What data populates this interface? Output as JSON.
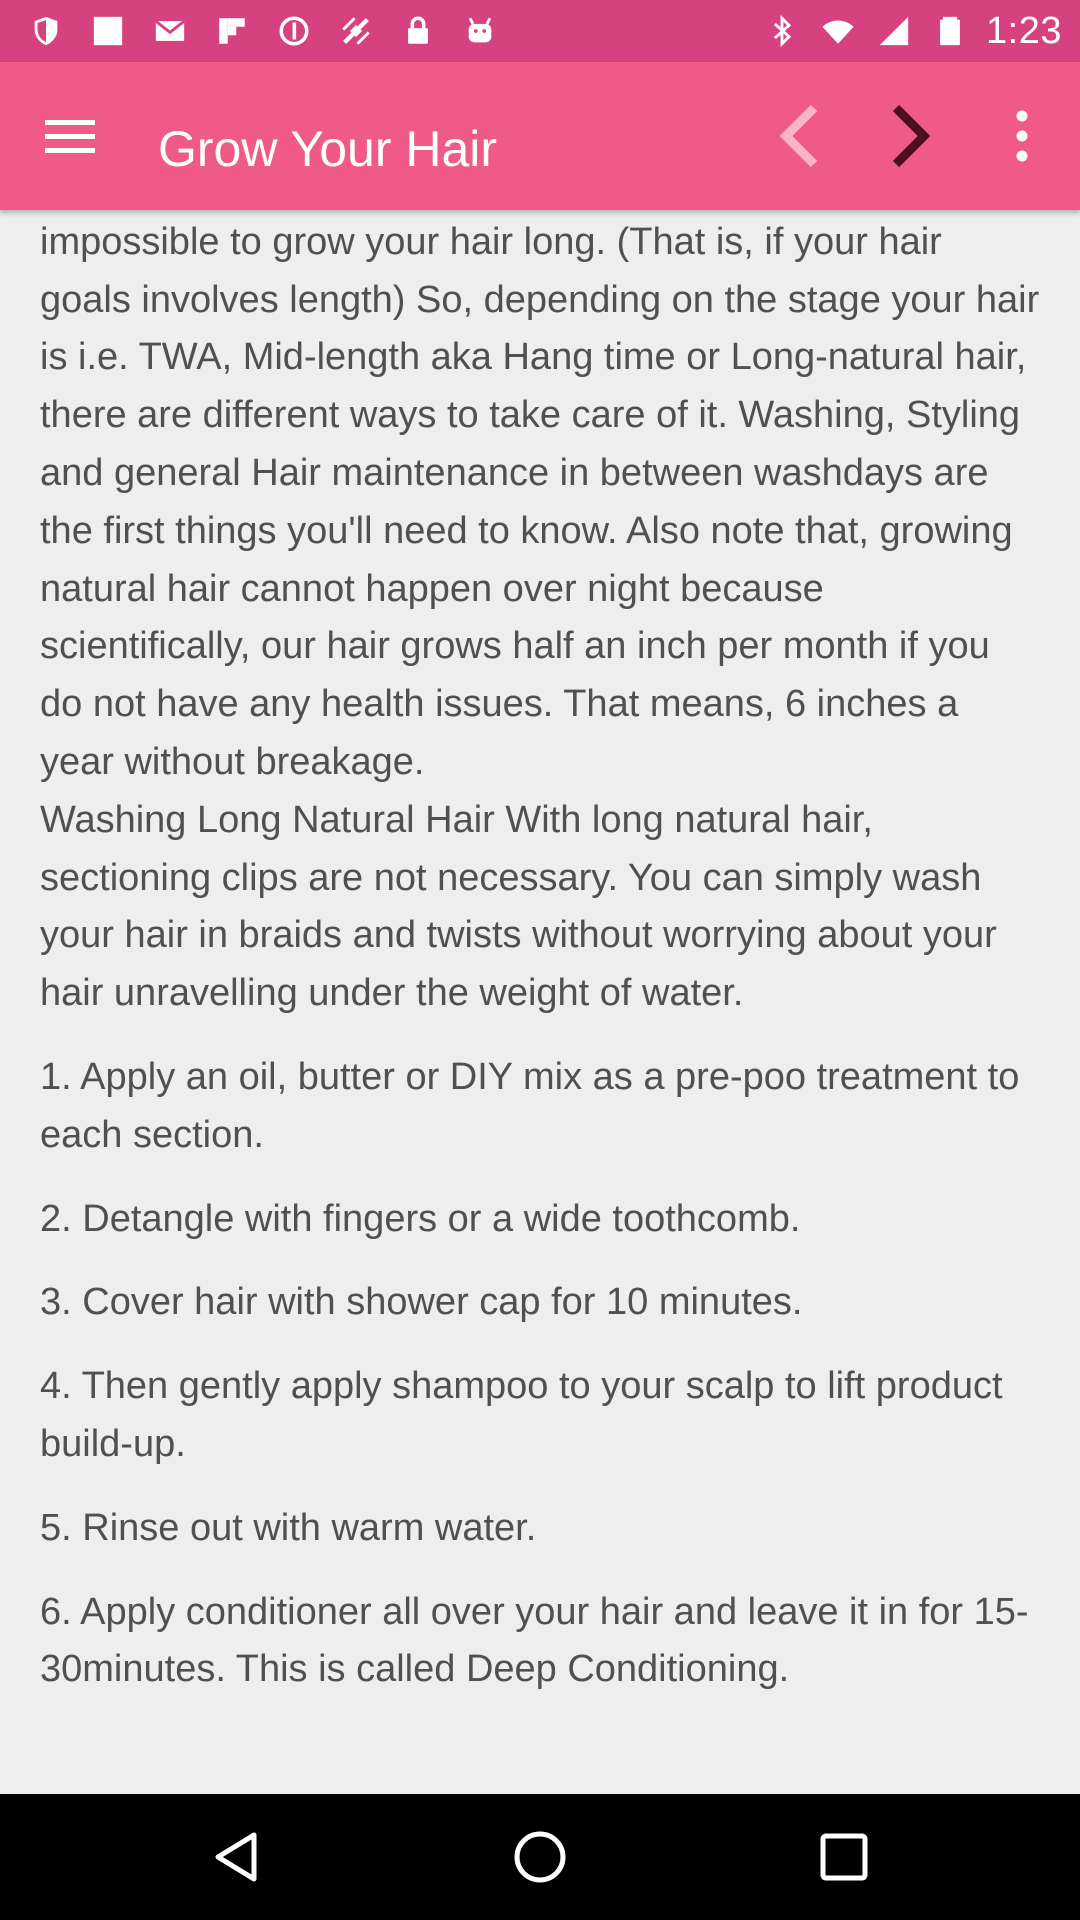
{
  "status_bar": {
    "time": "1:23",
    "left_icons": [
      "shield-icon",
      "blank-notification-icon",
      "mail-icon",
      "flipboard-icon",
      "circle-info-icon",
      "fake-gps-icon",
      "lock-icon",
      "android-icon"
    ],
    "right_icons": [
      "bluetooth-icon",
      "wifi-icon",
      "cellular-signal-icon",
      "battery-icon"
    ]
  },
  "app_bar": {
    "title": "Grow Your Hair",
    "background_color": "#f05a86",
    "status_color": "#d6427f"
  },
  "article": {
    "paragraph_1": "Without a good regimen for your natural hair, it is almost impossible to grow your hair long. (That is, if your hair goals involves length) So, depending on the stage your hair is i.e. TWA, Mid-length aka Hang time or Long-natural hair, there are different ways to take care of it. Washing, Styling and general Hair maintenance in between washdays are the first things you'll need to know. Also note that, growing natural hair cannot happen over night because scientifically, our hair grows half an inch per month if you do not have any health issues. That means, 6 inches a year without breakage.",
    "paragraph_2": "Washing Long Natural Hair With long natural hair, sectioning clips are not necessary. You can simply wash your hair in braids and twists without worrying about your hair unravelling under the weight of water.",
    "steps": [
      "1. Apply an oil, butter or DIY mix as a pre-poo treatment to each section.",
      "2. Detangle with fingers or a wide toothcomb.",
      "3. Cover hair with shower cap for 10 minutes.",
      "4. Then gently apply shampoo to your scalp to lift product build-up.",
      "5. Rinse out with warm water.",
      "6. Apply conditioner all over your hair and leave it in for 15-30minutes. This is called Deep Conditioning."
    ],
    "text_color": "#505050"
  },
  "navigation_bar": {
    "buttons": [
      "back-triangle-icon",
      "home-circle-icon",
      "recents-square-icon"
    ]
  }
}
